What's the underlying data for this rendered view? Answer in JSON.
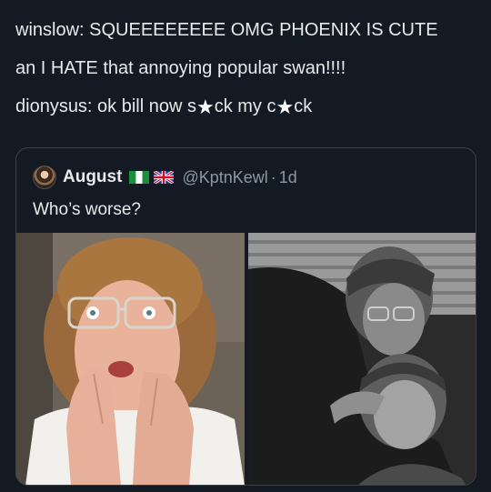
{
  "post": {
    "line1": "winslow: SQUEEEEEEEE OMG PHOENIX IS CUTE",
    "line2": "an I HATE that annoying popular swan!!!!",
    "line3_a": "dionysus: ok bill now s",
    "line3_b": "ck my c",
    "line3_c": "ck",
    "censor_icon": "white-star"
  },
  "quote": {
    "display_name": "August",
    "flags": [
      "nigeria-flag-icon",
      "uk-flag-icon"
    ],
    "handle": "@KptnKewl",
    "separator": "·",
    "time": "1d",
    "body": "Who’s worse?"
  },
  "media": {
    "left_image": "color-photo-man-glasses-hands-at-mouth",
    "right_image": "bw-photo-man-glasses-holding-boy"
  },
  "colors": {
    "background": "#141a24",
    "text": "#e7e9ea",
    "muted": "#8b98a5",
    "border": "#38444d"
  }
}
